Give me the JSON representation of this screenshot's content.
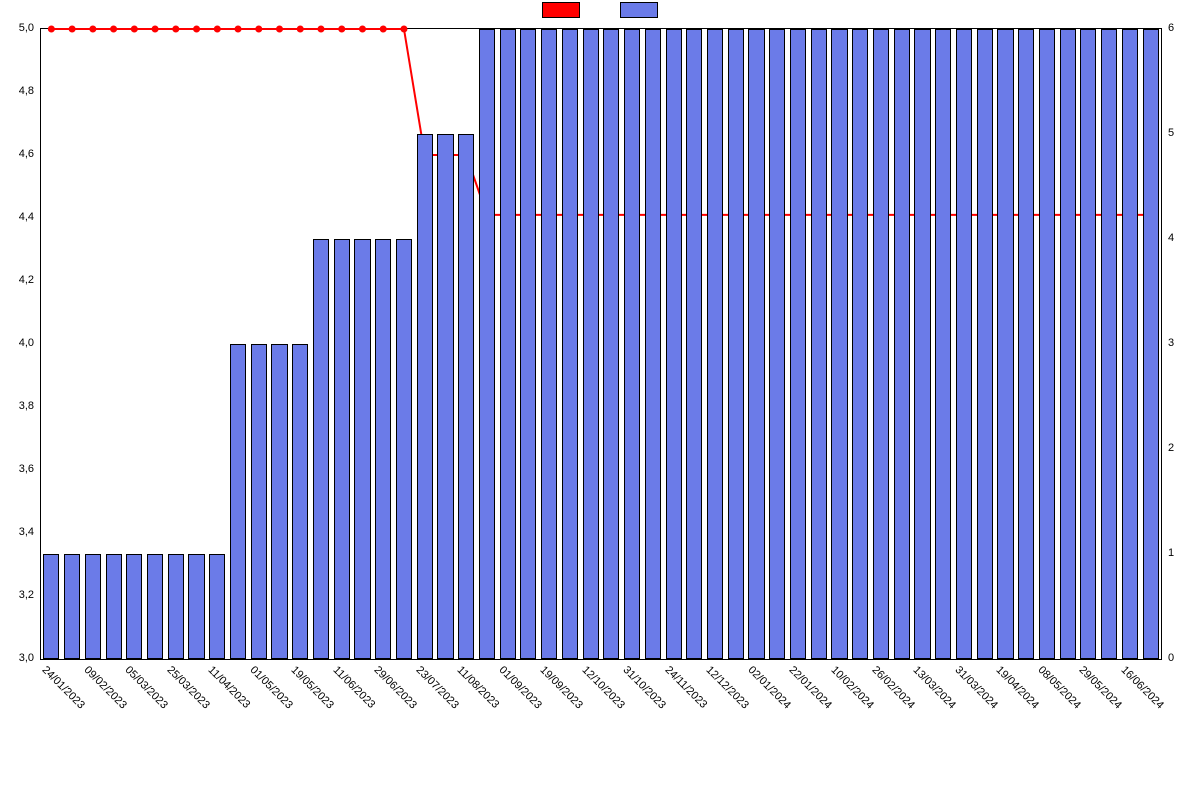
{
  "legend": {
    "series_line_label": "",
    "series_bar_label": ""
  },
  "chart_data": {
    "type": "bar",
    "categories": [
      "24/01/2023",
      "09/02/2023",
      "05/03/2023",
      "25/03/2023",
      "11/04/2023",
      "01/05/2023",
      "19/05/2023",
      "11/06/2023",
      "29/06/2023",
      "23/07/2023",
      "11/08/2023",
      "01/09/2023",
      "19/09/2023",
      "12/10/2023",
      "31/10/2023",
      "24/11/2023",
      "12/12/2023",
      "02/01/2024",
      "22/01/2024",
      "10/02/2024",
      "26/02/2024",
      "13/03/2024",
      "31/03/2024",
      "19/04/2024",
      "08/05/2024",
      "29/05/2024",
      "16/06/2024"
    ],
    "subticks_per_label": 2,
    "series": [
      {
        "name": "bars",
        "kind": "bar",
        "axis": "right",
        "color": "#6b7be8",
        "values": [
          1,
          1,
          1,
          1,
          1,
          1,
          1,
          1,
          1,
          3,
          3,
          3,
          3,
          4,
          4,
          4,
          4,
          4,
          5,
          5,
          5,
          6,
          6,
          6,
          6,
          6,
          6,
          6,
          6,
          6,
          6,
          6,
          6,
          6,
          6,
          6,
          6,
          6,
          6,
          6,
          6,
          6,
          6,
          6,
          6,
          6,
          6,
          6,
          6,
          6,
          6,
          6,
          6,
          6
        ]
      },
      {
        "name": "line",
        "kind": "line",
        "axis": "left",
        "color": "#ff0000",
        "values": [
          5.0,
          5.0,
          5.0,
          5.0,
          5.0,
          5.0,
          5.0,
          5.0,
          5.0,
          5.0,
          5.0,
          5.0,
          5.0,
          5.0,
          5.0,
          5.0,
          5.0,
          5.0,
          4.6,
          4.6,
          4.6,
          4.41,
          4.41,
          4.41,
          4.41,
          4.41,
          4.41,
          4.41,
          4.41,
          4.41,
          4.41,
          4.41,
          4.41,
          4.41,
          4.41,
          4.41,
          4.41,
          4.41,
          4.41,
          4.41,
          4.41,
          4.41,
          4.41,
          4.41,
          4.41,
          4.41,
          4.41,
          4.41,
          4.41,
          4.41,
          4.41,
          4.41,
          4.41,
          4.41
        ]
      }
    ],
    "y_left": {
      "min": 3.0,
      "max": 5.0,
      "ticks": [
        3.0,
        3.2,
        3.4,
        3.6,
        3.8,
        4.0,
        4.2,
        4.4,
        4.6,
        4.8,
        5.0
      ],
      "fmt": "comma1"
    },
    "y_right": {
      "min": 0,
      "max": 6,
      "ticks": [
        0,
        1,
        2,
        3,
        4,
        5,
        6
      ],
      "fmt": "int"
    },
    "xlabel": "",
    "ylabel_left": "",
    "ylabel_right": ""
  }
}
